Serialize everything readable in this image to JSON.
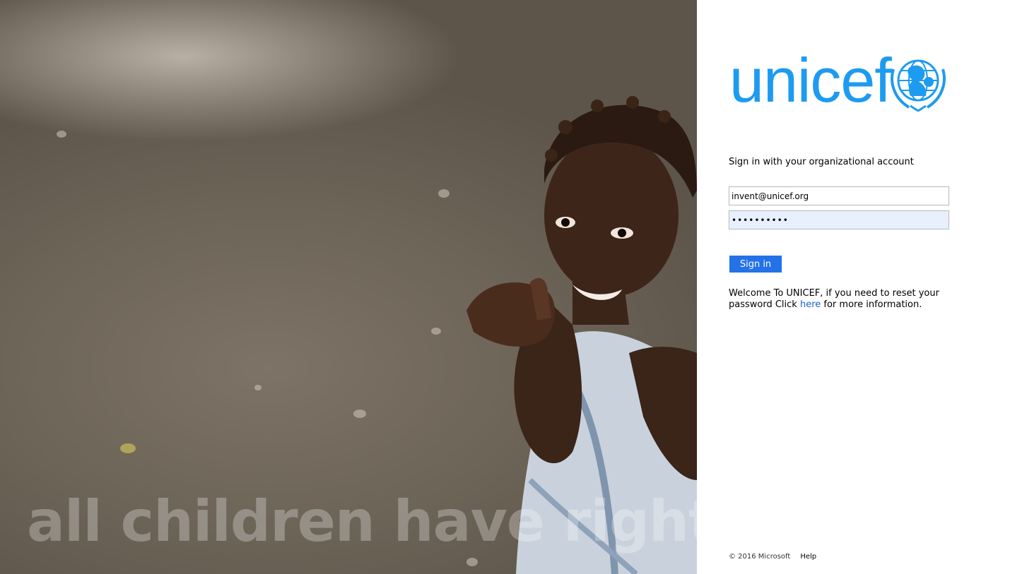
{
  "illustration": {
    "tagline": "all children have rights"
  },
  "brand": {
    "name": "unicef",
    "emblem_icon": "un-emblem-icon",
    "color": "#1d9bf0"
  },
  "signin": {
    "heading": "Sign in with your organizational account",
    "email_value": "invent@unicef.org",
    "password_value": "••••••••••",
    "button_label": "Sign in",
    "button_color": "#2372e8"
  },
  "welcome": {
    "text_before": "Welcome To UNICEF, if you need to reset your password Click ",
    "link_label": "here",
    "text_after": " for more information."
  },
  "footer": {
    "copyright": "© 2016 Microsoft",
    "help_label": "Help"
  }
}
